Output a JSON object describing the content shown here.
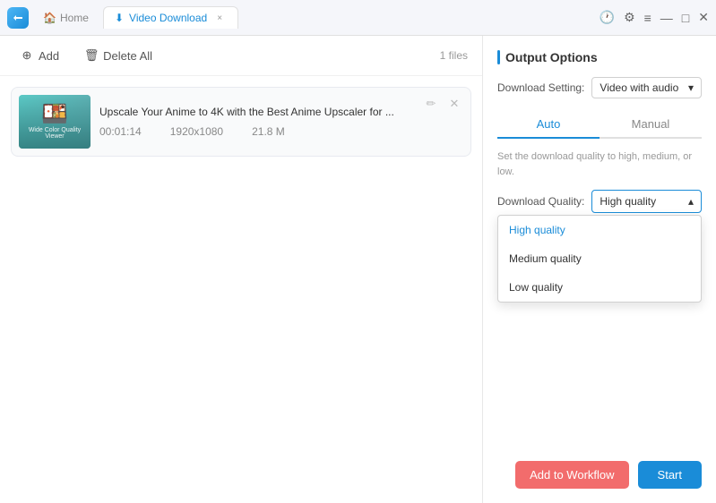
{
  "titleBar": {
    "appName": "App",
    "homeTab": "Home",
    "activeTab": "Video Download",
    "closeTab": "×"
  },
  "toolbar": {
    "addLabel": "Add",
    "deleteLabel": "Delete All",
    "filesCount": "1 files"
  },
  "fileItem": {
    "title": "Upscale Your Anime to 4K with the Best Anime Upscaler for ...",
    "duration": "00:01:14",
    "resolution": "1920x1080",
    "size": "21.8 M"
  },
  "outputOptions": {
    "title": "Output Options",
    "downloadSettingLabel": "Download Setting:",
    "downloadSettingValue": "Video with audio",
    "tabAuto": "Auto",
    "tabManual": "Manual",
    "hintText": "Set the download quality to high, medium, or low.",
    "qualityLabel": "Download Quality:",
    "qualityValue": "High quality",
    "qualityOptions": [
      {
        "value": "High quality",
        "selected": true
      },
      {
        "value": "Medium quality",
        "selected": false
      },
      {
        "value": "Low quality",
        "selected": false
      }
    ]
  },
  "buttons": {
    "addToWorkflow": "Add to Workflow",
    "start": "Start"
  }
}
